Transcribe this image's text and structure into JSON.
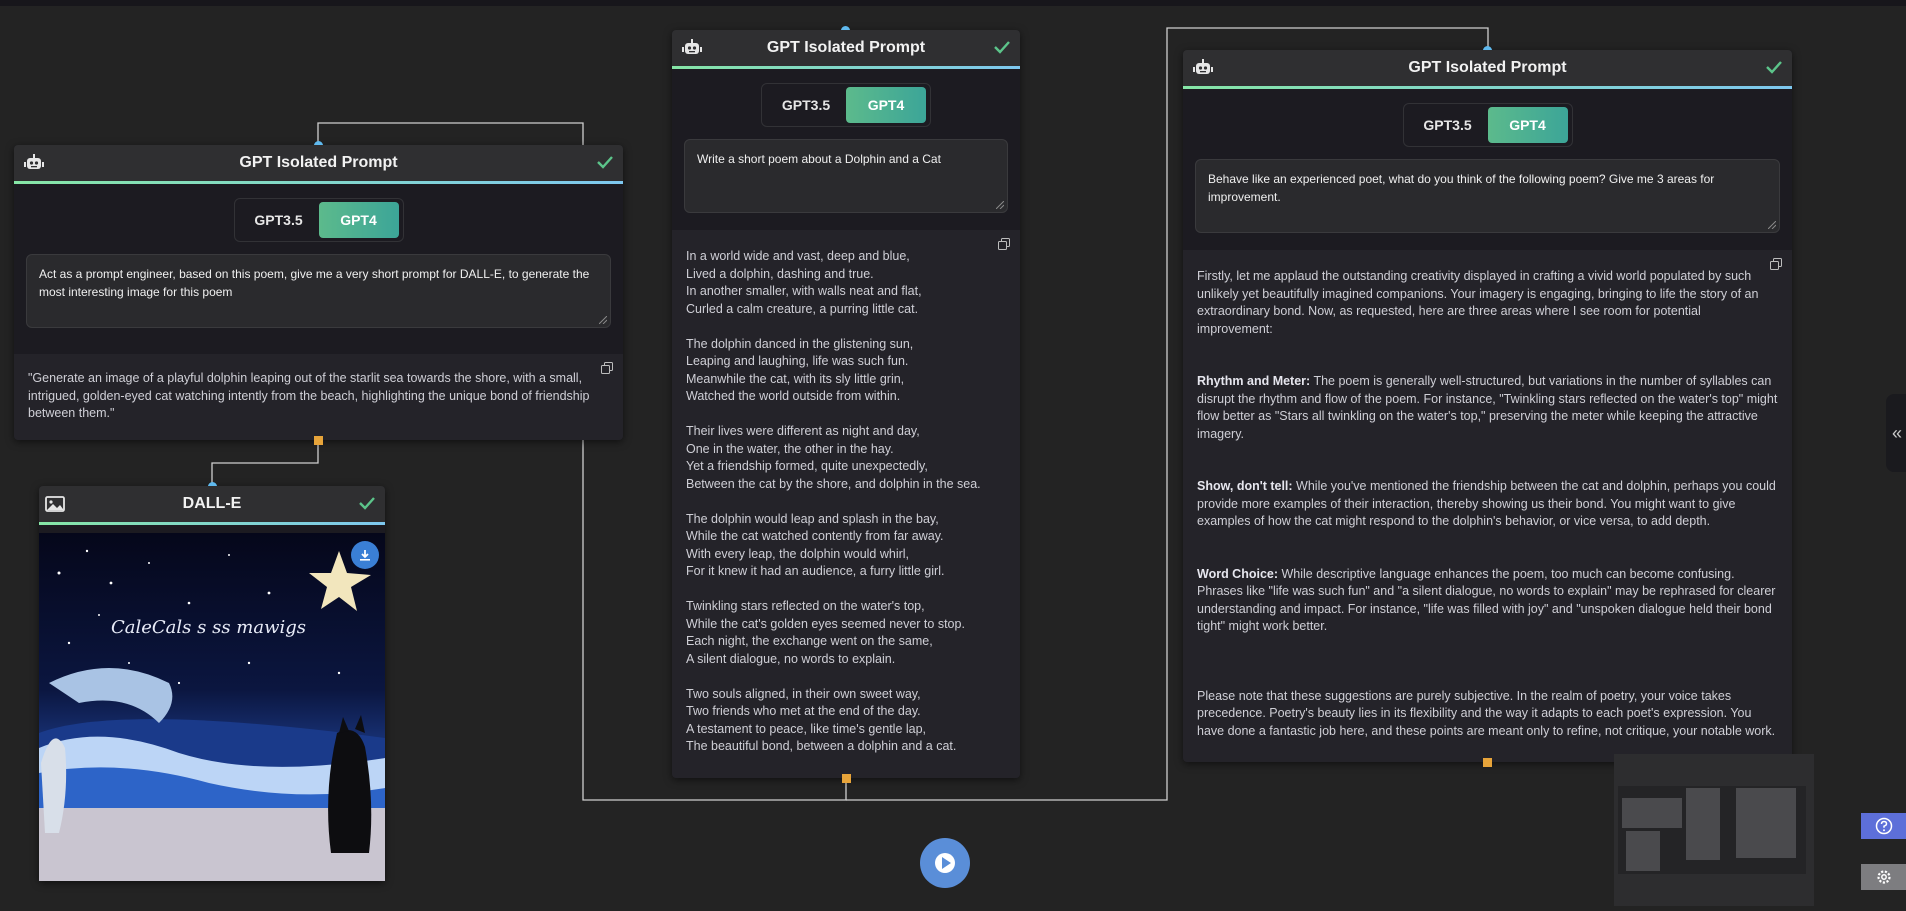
{
  "nodes": {
    "left": {
      "title": "GPT Isolated Prompt",
      "options": [
        "GPT3.5",
        "GPT4"
      ],
      "selected": "GPT4",
      "prompt": "Act as a prompt engineer, based on this poem, give me a very short prompt for DALL-E, to generate the most interesting image for this poem",
      "response": "\"Generate an image of a playful dolphin leaping out of the starlit sea towards the shore, with a small, intrigued, golden-eyed cat watching intently from the beach, highlighting the unique bond of friendship between them.\""
    },
    "center": {
      "title": "GPT Isolated Prompt",
      "options": [
        "GPT3.5",
        "GPT4"
      ],
      "selected": "GPT4",
      "prompt": "Write a short poem about a Dolphin and a Cat",
      "stanzas": [
        [
          "In a world wide and vast, deep and blue,",
          "Lived a dolphin, dashing and true.",
          "In another smaller, with walls neat and flat,",
          "Curled a calm creature, a purring little cat."
        ],
        [
          "The dolphin danced in the glistening sun,",
          "Leaping and laughing, life was such fun.",
          "Meanwhile the cat, with its sly little grin,",
          "Watched the world outside from within."
        ],
        [
          "Their lives were different as night and day,",
          "One in the water, the other in the hay.",
          "Yet a friendship formed, quite unexpectedly,",
          "Between the cat by the shore, and dolphin in the sea."
        ],
        [
          "The dolphin would leap and splash in the bay,",
          "While the cat watched contently from far away.",
          "With every leap, the dolphin would whirl,",
          "For it knew it had an audience, a furry little girl."
        ],
        [
          "Twinkling stars reflected on the water's top,",
          "While the cat's golden eyes seemed never to stop.",
          "Each night, the exchange went on the same,",
          "A silent dialogue, no words to explain."
        ],
        [
          "Two souls aligned, in their own sweet way,",
          "Two friends who met at the end of the day.",
          "A testament to peace, like time's gentle lap,",
          "The beautiful bond, between a dolphin and a cat."
        ]
      ]
    },
    "right": {
      "title": "GPT Isolated Prompt",
      "options": [
        "GPT3.5",
        "GPT4"
      ],
      "selected": "GPT4",
      "prompt": "Behave like an experienced poet, what do you think of the following poem? Give me 3 areas for improvement.",
      "intro": "Firstly, let me applaud the outstanding creativity displayed in crafting a vivid world populated by such unlikely yet beautifully imagined companions. Your imagery is engaging, bringing to life the story of an extraordinary bond. Now, as requested, here are three areas where I see room for potential improvement:",
      "points": [
        {
          "heading": "Rhythm and Meter:",
          "text": " The poem is generally well-structured, but variations in the number of syllables can disrupt the rhythm and flow of the poem. For instance, \"Twinkling stars reflected on the water's top\" might flow better as \"Stars all twinkling on the water's top,\" preserving the meter while keeping the attractive imagery."
        },
        {
          "heading": "Show, don't tell:",
          "text": " While you've mentioned the friendship between the cat and dolphin, perhaps you could provide more examples of their interaction, thereby showing us their bond. You might want to give examples of how the cat might respond to the dolphin's behavior, or vice versa, to add depth."
        },
        {
          "heading": "Word Choice:",
          "text": " While descriptive language enhances the poem, too much can become confusing. Phrases like \"life was such fun\" and \"a silent dialogue, no words to explain\" may be rephrased for clearer understanding and impact. For instance, \"life was filled with joy\" and \"unspoken dialogue held their bond tight\" might work better."
        }
      ],
      "outro": "Please note that these suggestions are purely subjective. In the realm of poetry, your voice takes precedence. Poetry's beauty lies in its flexibility and the way it adapts to each poet's expression. You have done a fantastic job here, and these points are meant only to refine, not critique, your notable work."
    },
    "dalle": {
      "title": "DALL-E",
      "image_text": "CaleCals s ss mawigs"
    }
  },
  "colors": {
    "accent_green": "#5cba8c",
    "port_in": "#5fb9ee",
    "port_out": "#e7a43a",
    "run_button": "#5a8ed8",
    "help_button": "#5d6fd9"
  },
  "controls": {
    "collapse_glyph": "«",
    "run_icon": "play-icon",
    "help_icon": "question-icon",
    "settings_icon": "gear-icon"
  }
}
